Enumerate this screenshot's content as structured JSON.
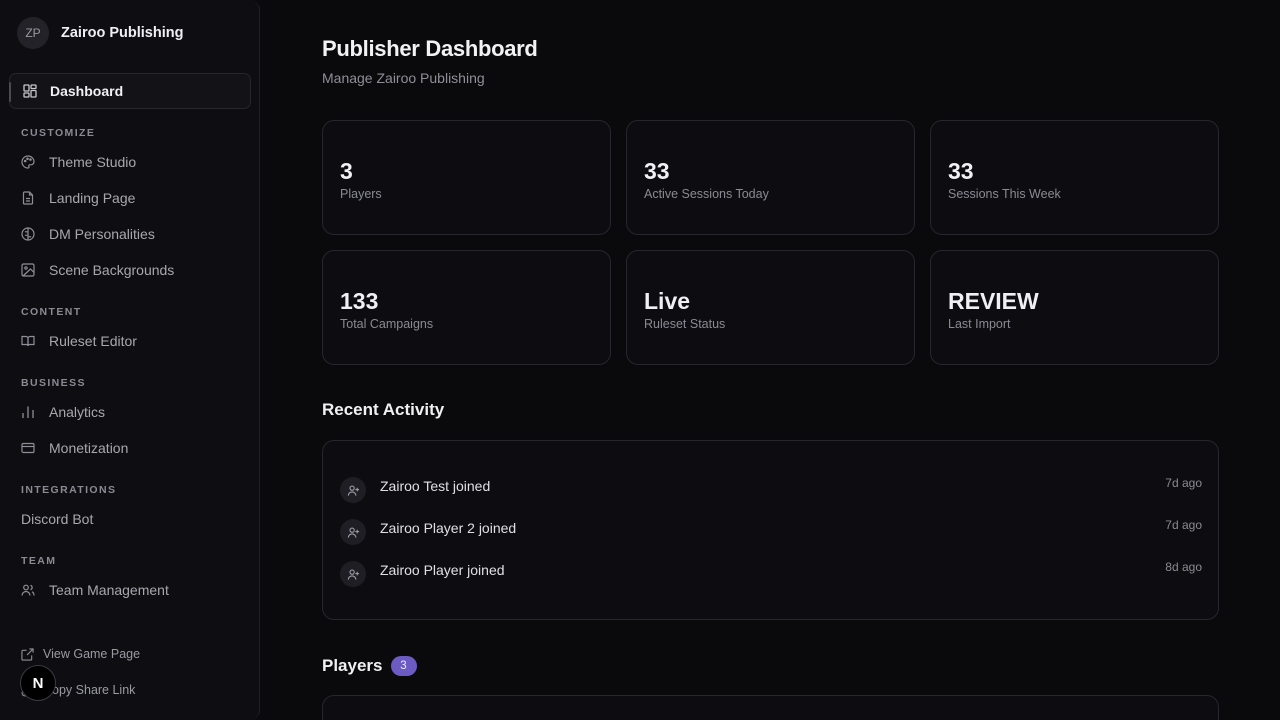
{
  "brand": {
    "initials": "ZP",
    "name": "Zairoo Publishing"
  },
  "nav": {
    "active": {
      "label": "Dashboard",
      "icon": "dashboard-icon"
    },
    "sections": [
      {
        "title": "CUSTOMIZE",
        "items": [
          {
            "label": "Theme Studio",
            "icon": "palette-icon"
          },
          {
            "label": "Landing Page",
            "icon": "file-icon"
          },
          {
            "label": "DM Personalities",
            "icon": "brain-icon"
          },
          {
            "label": "Scene Backgrounds",
            "icon": "image-icon"
          }
        ]
      },
      {
        "title": "CONTENT",
        "items": [
          {
            "label": "Ruleset Editor",
            "icon": "book-icon"
          }
        ]
      },
      {
        "title": "BUSINESS",
        "items": [
          {
            "label": "Analytics",
            "icon": "bar-chart-icon"
          },
          {
            "label": "Monetization",
            "icon": "credit-card-icon"
          }
        ]
      },
      {
        "title": "INTEGRATIONS",
        "items": [
          {
            "label": "Discord Bot"
          }
        ]
      },
      {
        "title": "TEAM",
        "items": [
          {
            "label": "Team Management",
            "icon": "users-icon"
          }
        ]
      }
    ],
    "footer": {
      "view_game_page": "View Game Page",
      "copy_share_link": "Copy Share Link",
      "n_badge": "N"
    }
  },
  "header": {
    "title": "Publisher Dashboard",
    "subtitle": "Manage Zairoo Publishing"
  },
  "stats": [
    {
      "value": "3",
      "label": "Players"
    },
    {
      "value": "33",
      "label": "Active Sessions Today"
    },
    {
      "value": "33",
      "label": "Sessions This Week"
    },
    {
      "value": "133",
      "label": "Total Campaigns"
    },
    {
      "value": "Live",
      "label": "Ruleset Status"
    },
    {
      "value": "REVIEW",
      "label": "Last Import"
    }
  ],
  "recent_activity": {
    "title": "Recent Activity",
    "items": [
      {
        "text": "Zairoo Test joined",
        "time": "7d ago"
      },
      {
        "text": "Zairoo Player 2 joined",
        "time": "7d ago"
      },
      {
        "text": "Zairoo Player joined",
        "time": "8d ago"
      }
    ]
  },
  "players": {
    "title": "Players",
    "count": "3"
  },
  "colors": {
    "accent": "#6d5bc4",
    "background": "#0a0a0c",
    "card_border": "#26262c"
  }
}
